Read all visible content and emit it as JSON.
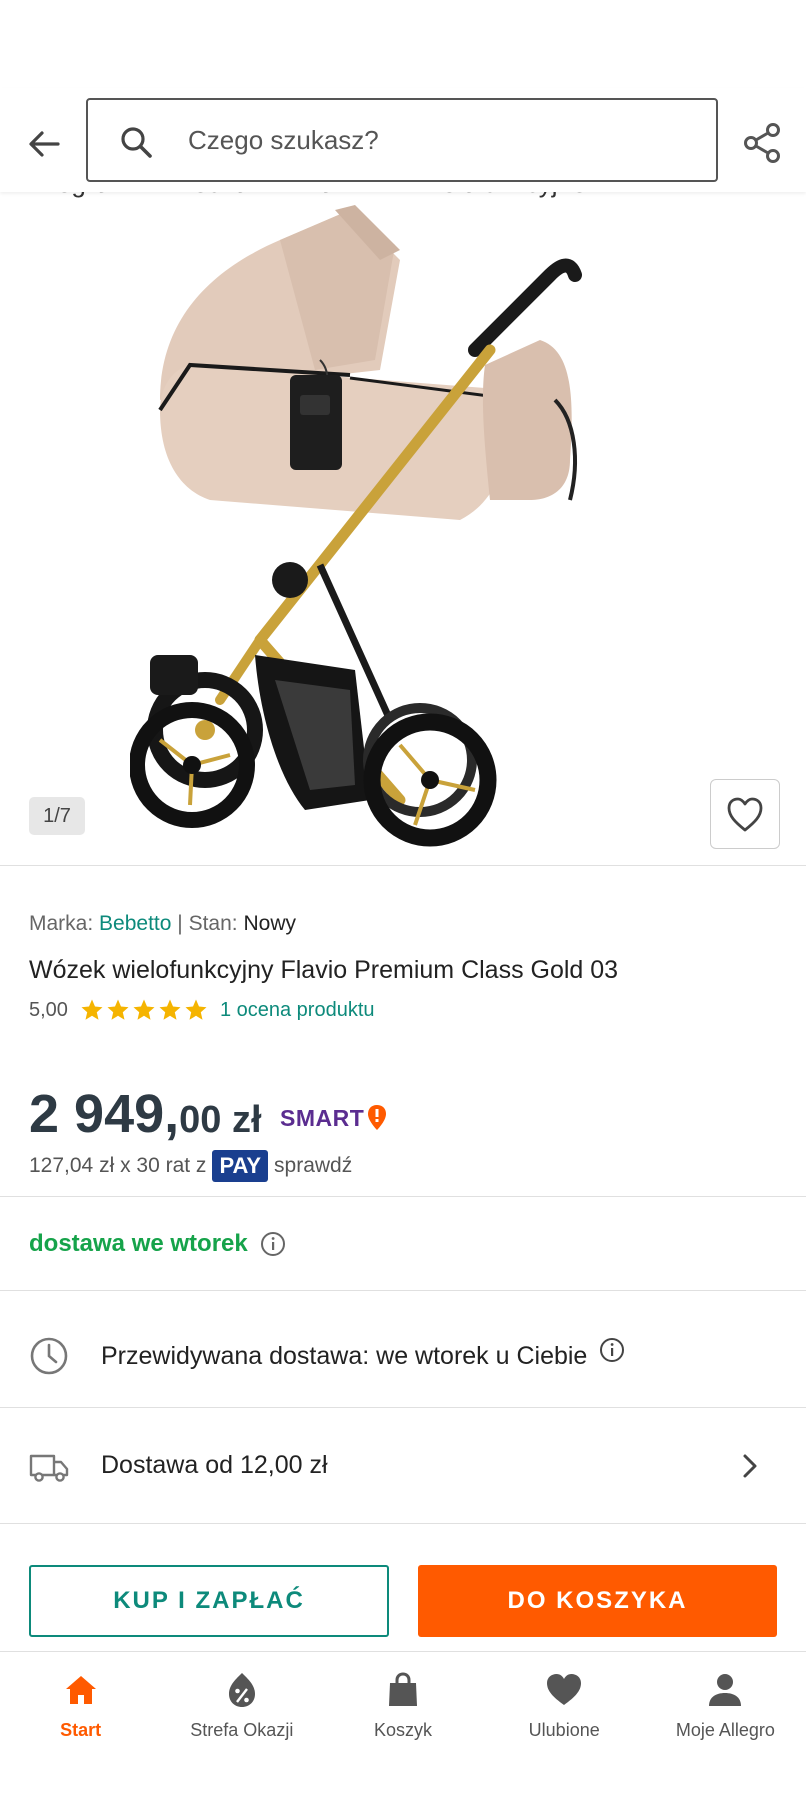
{
  "header": {
    "search_placeholder": "Czego szukasz?"
  },
  "breadcrumb": [
    "Allegro",
    "Dziecko",
    "Wózki",
    "Wielofunkcyjne"
  ],
  "gallery": {
    "counter": "1/7"
  },
  "product": {
    "brand_label": "Marka:",
    "brand_value": "Bebetto",
    "separator": "|",
    "condition_label": "Stan:",
    "condition_value": "Nowy",
    "title": "Wózek wielofunkcyjny Flavio Premium Class Gold 03",
    "rating_value": "5,00",
    "rating_stars": 5,
    "rating_link": "1 ocena produktu"
  },
  "price": {
    "main": "2 949,",
    "fraction_currency": "00 zł",
    "smart_label": "SMART",
    "installments": "127,04 zł x 30 rat z",
    "pay_badge": "PAY",
    "check_link": "sprawdź"
  },
  "delivery": {
    "day_label": "dostawa we wtorek",
    "expected": "Przewidywana dostawa: we wtorek u Ciebie",
    "cost": "Dostawa od 12,00 zł"
  },
  "actions": {
    "buy_label": "KUP I ZAPŁAĆ",
    "cart_label": "DO KOSZYKA"
  },
  "bottom_nav": [
    {
      "label": "Start",
      "icon": "home-icon",
      "active": true
    },
    {
      "label": "Strefa Okazji",
      "icon": "deals-icon",
      "active": false
    },
    {
      "label": "Koszyk",
      "icon": "shopping-bag-icon",
      "active": false
    },
    {
      "label": "Ulubione",
      "icon": "heart-icon",
      "active": false
    },
    {
      "label": "Moje Allegro",
      "icon": "user-icon",
      "active": false
    }
  ],
  "colors": {
    "accent_orange": "#ff5a00",
    "teal": "#0d8a7b",
    "green": "#16a34a",
    "price": "#2e3a44",
    "smart_purple": "#5b2d90",
    "pay_blue": "#1a3f8f"
  }
}
